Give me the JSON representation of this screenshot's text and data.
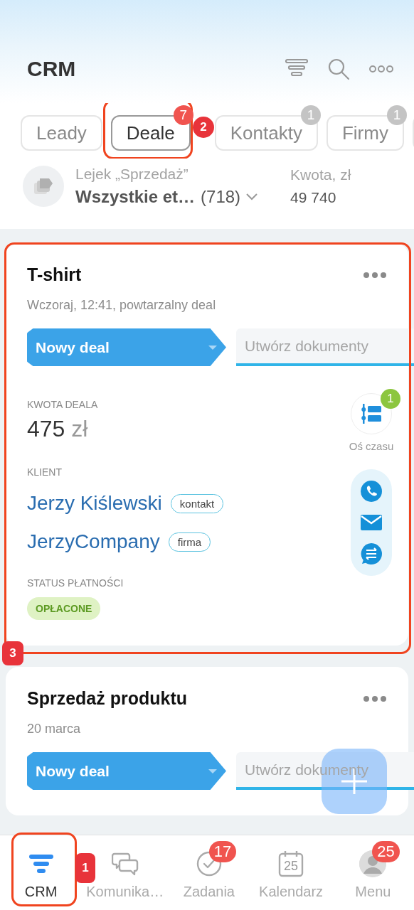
{
  "header": {
    "title": "CRM"
  },
  "tabs": [
    {
      "label": "Leady",
      "selected": false
    },
    {
      "label": "Deale",
      "selected": true,
      "badge": "7",
      "color": "#f0544f"
    },
    {
      "label": "Kontakty",
      "selected": false,
      "badge": "1",
      "color": "#c4c4c4"
    },
    {
      "label": "Firmy",
      "selected": false,
      "badge": "1",
      "color": "#c4c4c4"
    }
  ],
  "pipeline": {
    "funnel": "Lejek „Sprzedaż”",
    "stage": "Wszystkie et…",
    "count": "(718)",
    "amount_label": "Kwota, zł",
    "amount": "49 740"
  },
  "deals": [
    {
      "title": "T-shirt",
      "subtitle": "Wczoraj, 12:41, powtarzalny deal",
      "stage": "Nowy deal",
      "documents": "Utwórz dokumenty",
      "amount_label": "KWOTA DEALA",
      "amount": "475",
      "currency": "zł",
      "client_label": "KLIENT",
      "clients": [
        {
          "name": "Jerzy Kiślewski",
          "tag": "kontakt"
        },
        {
          "name": "JerzyCompany",
          "tag": "firma"
        }
      ],
      "status_label": "STATUS PŁATNOŚCI",
      "status": "OPŁACONE",
      "timeline_badge": "1",
      "timeline_label": "Oś czasu"
    },
    {
      "title": "Sprzedaż produktu",
      "subtitle": "20 marca",
      "stage": "Nowy deal",
      "documents": "Utwórz dokumenty"
    }
  ],
  "nav": [
    {
      "kind": "funnel",
      "label": "CRM",
      "selected": true
    },
    {
      "kind": "chat",
      "label": "Komunika…",
      "selected": false
    },
    {
      "kind": "check",
      "label": "Zadania",
      "selected": false,
      "badge": "17"
    },
    {
      "kind": "calendar",
      "label": "Kalendarz",
      "selected": false,
      "icon_text": "25"
    },
    {
      "kind": "avatar",
      "label": "Menu",
      "selected": false,
      "badge": "25"
    }
  ],
  "callouts": [
    {
      "label": "1"
    },
    {
      "label": "2"
    },
    {
      "label": "3"
    }
  ]
}
